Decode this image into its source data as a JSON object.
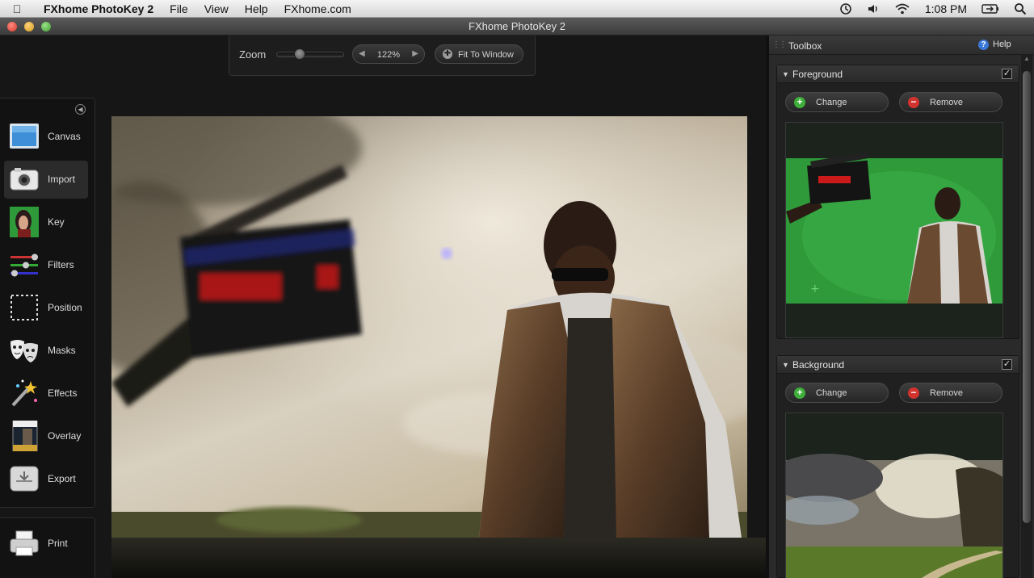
{
  "menubar": {
    "app_name": "FXhome PhotoKey 2",
    "menus": [
      "File",
      "View",
      "Help",
      "FXhome.com"
    ],
    "clock": "1:08 PM"
  },
  "window": {
    "title": "FXhome PhotoKey 2"
  },
  "zoom": {
    "label": "Zoom",
    "value": "122%",
    "fit_label": "Fit To Window",
    "slider_level": 0.33
  },
  "tools": [
    {
      "label": "Canvas",
      "icon": "canvas-icon",
      "active": false
    },
    {
      "label": "Import",
      "icon": "camera-icon",
      "active": true
    },
    {
      "label": "Key",
      "icon": "key-icon",
      "active": false
    },
    {
      "label": "Filters",
      "icon": "filters-icon",
      "active": false
    },
    {
      "label": "Position",
      "icon": "position-icon",
      "active": false
    },
    {
      "label": "Masks",
      "icon": "masks-icon",
      "active": false
    },
    {
      "label": "Effects",
      "icon": "effects-icon",
      "active": false
    },
    {
      "label": "Overlay",
      "icon": "overlay-icon",
      "active": false
    },
    {
      "label": "Export",
      "icon": "export-icon",
      "active": false
    }
  ],
  "print": {
    "label": "Print",
    "icon": "printer-icon"
  },
  "toolbox": {
    "title": "Toolbox",
    "help": "Help",
    "sections": {
      "foreground": {
        "title": "Foreground",
        "change": "Change",
        "remove": "Remove",
        "enabled": true
      },
      "background": {
        "title": "Background",
        "change": "Change",
        "remove": "Remove",
        "enabled": true
      }
    }
  },
  "colors": {
    "accent_blue": "#3a78d8",
    "change_green": "#3fae3a",
    "remove_red": "#d2332f",
    "greenscreen": "#2f9a3a"
  }
}
